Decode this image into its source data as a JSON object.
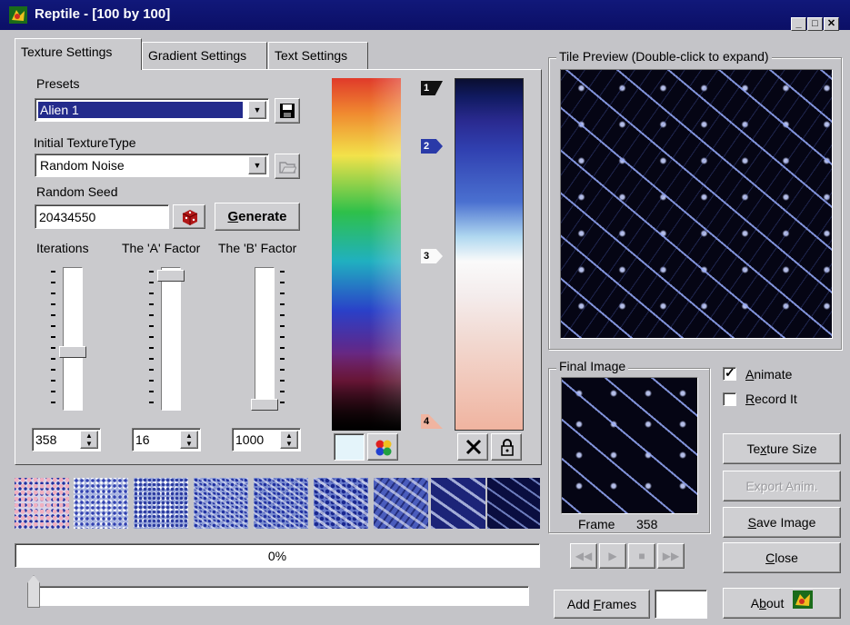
{
  "window": {
    "title": "Reptile - [100 by 100]",
    "controls": [
      "_",
      "□",
      "✕"
    ]
  },
  "tabs": [
    {
      "label": "Texture Settings",
      "active": true
    },
    {
      "label": "Gradient Settings",
      "active": false
    },
    {
      "label": "Text Settings",
      "active": false
    }
  ],
  "presets": {
    "label": "Presets",
    "value": "Alien 1"
  },
  "texture_type": {
    "label": "Initial TextureType",
    "value": "Random Noise"
  },
  "seed": {
    "label": "Random Seed",
    "value": "20434550",
    "generate_label": "Generate"
  },
  "sliders": [
    {
      "label": "Iterations",
      "value": "358",
      "level": 0.4
    },
    {
      "label": "The 'A' Factor",
      "value": "16",
      "level": 0.98
    },
    {
      "label": "The 'B' Factor",
      "value": "1000",
      "level": 0.0
    }
  ],
  "gradient_markers": [
    "1",
    "2",
    "3",
    "4"
  ],
  "progress": {
    "text": "0%",
    "level": 0.0
  },
  "tile_preview": {
    "label": "Tile Preview (Double-click to expand)"
  },
  "final_image": {
    "label": "Final Image",
    "frame_label": "Frame",
    "frame_value": "358"
  },
  "options": {
    "animate": {
      "label": "Animate",
      "checked": true
    },
    "record": {
      "label": "Record It",
      "checked": false
    }
  },
  "buttons": {
    "texture_size": "Texture Size",
    "export_anim": "Export Anim.",
    "save_image": "Save Image",
    "close": "Close",
    "about": "About",
    "add_frames": "Add Frames"
  },
  "icons": {
    "app": "reptile-app-icon",
    "save": "floppy-disk-icon",
    "open": "folder-open-icon",
    "dice": "dice-icon",
    "palette": "palette-icon",
    "delete": "x-delete-icon",
    "lock": "padlock-icon"
  },
  "colors": {
    "titlebar": "#0b0f66",
    "selection": "#232b8c",
    "preview_bg": "#050514"
  }
}
